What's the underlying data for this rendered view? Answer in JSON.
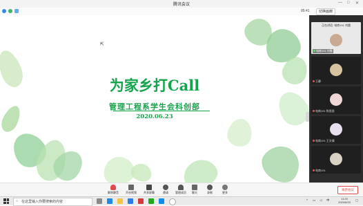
{
  "window": {
    "title": "腾讯会议",
    "controls": [
      "—",
      "□",
      "✕"
    ]
  },
  "infobar": {
    "timer": "05:41",
    "grid_label": "切换画廊"
  },
  "slide": {
    "title": "为家乡打Call",
    "subtitle": "管理工程系学生会科创部",
    "date": "2020.06.23"
  },
  "panel": {
    "speaking_banner": "正在讲话: 电商191 刘霞",
    "participants": [
      {
        "name": "电商191 刘霞"
      },
      {
        "name": "王静"
      },
      {
        "name": "电商191 陈思凯"
      },
      {
        "name": "电商191 王文倩"
      },
      {
        "name": "电商191"
      }
    ]
  },
  "toolbar": {
    "items": [
      "解除静音",
      "开启视频",
      "共享屏幕",
      "邀请",
      "管理成员",
      "聊天",
      "录制",
      "更多"
    ],
    "leave_label": "离开会议"
  },
  "taskbar": {
    "search_placeholder": "在这里输入你要搜索的内容",
    "clock_time": "11:20",
    "clock_date": "2020/6/23",
    "tray_lang": "中"
  }
}
